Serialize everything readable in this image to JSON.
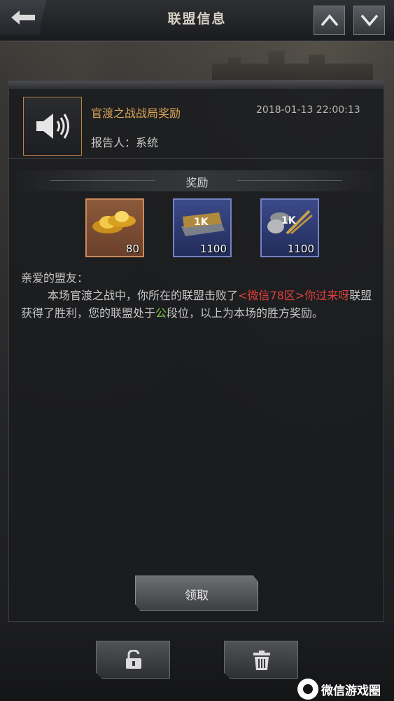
{
  "header": {
    "title": "联盟信息"
  },
  "mail": {
    "title": "官渡之战战局奖励",
    "date": "2018-01-13 22:00:13",
    "reporter": "报告人：系统"
  },
  "rewards": {
    "label": "奖励",
    "items": [
      {
        "icon": "gold-ingot-icon",
        "count": "80"
      },
      {
        "icon": "1k-resource-icon",
        "count": "1100"
      },
      {
        "icon": "1k-coin-grain-icon",
        "count": "1100"
      }
    ]
  },
  "message": {
    "greeting": "亲爱的盟友：",
    "part1": "本场官渡之战中，你所在的联盟击败了",
    "enemy": "<微信78区>你过来呀",
    "part2": "联盟获得了胜利，您的联盟处于",
    "rank": "公",
    "part3": "段位，以上为本场的胜方奖励。"
  },
  "actions": {
    "claim_label": "领取"
  },
  "watermark": {
    "text": "微信游戏圈"
  },
  "colors": {
    "accent_gold": "#d9a45a",
    "enemy_red": "#e1403c",
    "rank_green": "#7dc241"
  }
}
